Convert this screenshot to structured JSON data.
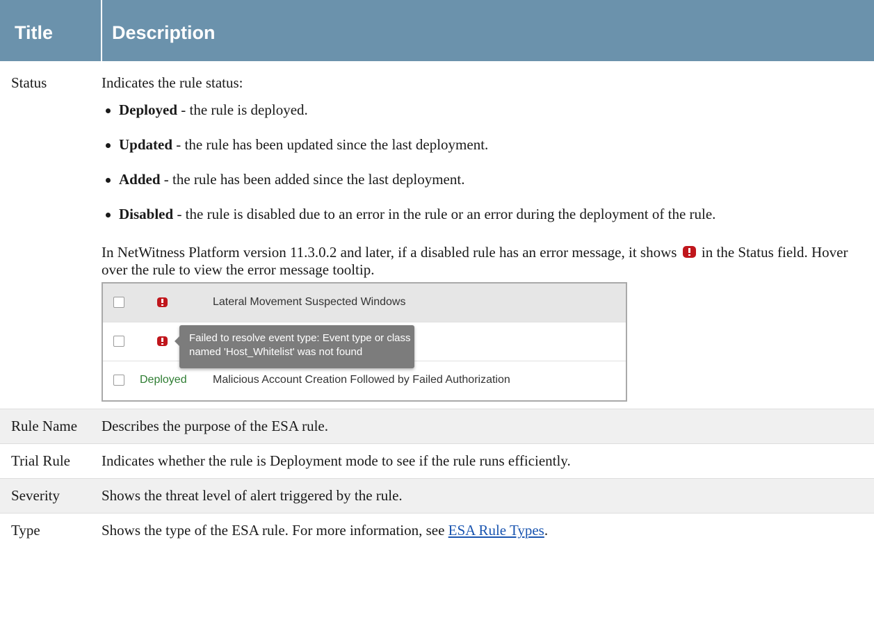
{
  "header": {
    "col_title": "Title",
    "col_description": "Description"
  },
  "status_row": {
    "title": "Status",
    "intro": "Indicates the rule status:",
    "bullets": [
      {
        "term": "Deployed",
        "text": " - the rule is deployed."
      },
      {
        "term": "Updated",
        "text": " - the rule has been updated since the last deployment."
      },
      {
        "term": "Added",
        "text": " - the rule has been added since the last deployment."
      },
      {
        "term": "Disabled",
        "text": " - the rule is disabled due to an error in the rule or an error during the deployment of the rule."
      }
    ],
    "note_before": "In NetWitness Platform version 11.3.0.2 and later, if a disabled rule has an error message, it shows ",
    "note_after": " in the Status field. Hover over the rule to view the error message tooltip.",
    "screenshot": {
      "rows": [
        {
          "status": "",
          "rule": "Lateral Movement Suspected Windows"
        },
        {
          "status": "",
          "rule": ""
        },
        {
          "status": "Deployed",
          "rule": "Malicious Account Creation Followed by Failed Authorization"
        }
      ],
      "tooltip": "Failed to resolve event type: Event type or class named 'Host_Whitelist' was not found"
    }
  },
  "rows": [
    {
      "title": "Rule Name",
      "description": "Describes the purpose of the ESA rule."
    },
    {
      "title": "Trial Rule",
      "description": "Indicates whether the rule is Deployment mode to see if the rule runs efficiently."
    },
    {
      "title": "Severity",
      "description": "Shows the threat level of alert triggered by the rule."
    }
  ],
  "type_row": {
    "title": "Type",
    "text_before": "Shows the type of the ESA rule. For more information, see ",
    "link_text": "ESA Rule Types",
    "text_after": "."
  }
}
